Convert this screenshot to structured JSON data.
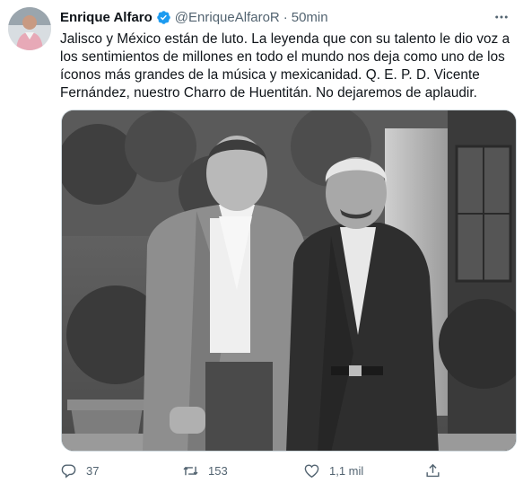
{
  "author": {
    "name": "Enrique Alfaro",
    "handle": "@EnriqueAlfaroR",
    "separator": "·",
    "time": "50min",
    "verified_icon": "verified-badge-icon",
    "brand_color": "#1d9bf0"
  },
  "tweet": {
    "lines": [
      "Jalisco y México están de luto. La leyenda que con su talento le dio voz a",
      "los sentimientos de millones en todo el mundo nos deja como uno de los",
      "íconos más grandes de la música y mexicanidad. Q. E. P. D. Vicente",
      "Fernández, nuestro Charro de Huentitán. No dejaremos de aplaudir."
    ]
  },
  "actions": {
    "reply": {
      "icon": "reply-icon",
      "count": "37"
    },
    "retweet": {
      "icon": "retweet-icon",
      "count": "153"
    },
    "like": {
      "icon": "heart-icon",
      "count": "1,1 mil"
    },
    "share": {
      "icon": "share-icon"
    }
  },
  "colors": {
    "text": "#0f1419",
    "secondary": "#536471",
    "border": "#cfd9de"
  }
}
